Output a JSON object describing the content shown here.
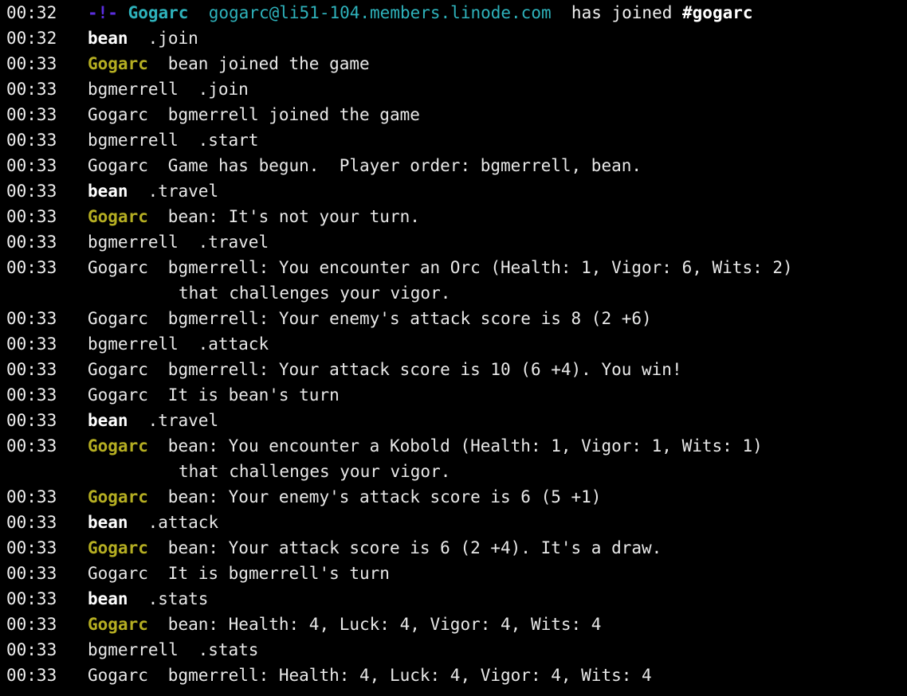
{
  "terminal": {
    "background_color": "#000000",
    "foreground_color": "#e8e8e8",
    "highlight_nick_color": "#b5ae22",
    "join_nick_color": "#2eb2bb",
    "join_prefix_color": "#5b2ee0",
    "own_nick_color": "#ffffff",
    "channel": "#gogarc",
    "own_nick": "bean"
  },
  "join_line": {
    "timestamp": "00:32",
    "prefix": "-!-",
    "nick": "Gogarc",
    "hostmask": "gogarc@li51-104.members.linode.com",
    "action": "has joined",
    "channel": "#gogarc"
  },
  "lines": [
    {
      "timestamp": "00:32",
      "nick": "bean",
      "style": "bold",
      "message": ".join"
    },
    {
      "timestamp": "00:33",
      "nick": "Gogarc",
      "style": "olive",
      "message": "bean joined the game"
    },
    {
      "timestamp": "00:33",
      "nick": "bgmerrell",
      "style": "plain",
      "message": ".join"
    },
    {
      "timestamp": "00:33",
      "nick": "Gogarc",
      "style": "plain",
      "message": "bgmerrell joined the game"
    },
    {
      "timestamp": "00:33",
      "nick": "bgmerrell",
      "style": "plain",
      "message": ".start"
    },
    {
      "timestamp": "00:33",
      "nick": "Gogarc",
      "style": "plain",
      "message": "Game has begun.  Player order: bgmerrell, bean."
    },
    {
      "timestamp": "00:33",
      "nick": "bean",
      "style": "bold",
      "message": ".travel"
    },
    {
      "timestamp": "00:33",
      "nick": "Gogarc",
      "style": "olive",
      "message": "bean: It's not your turn."
    },
    {
      "timestamp": "00:33",
      "nick": "bgmerrell",
      "style": "plain",
      "message": ".travel"
    },
    {
      "timestamp": "00:33",
      "nick": "Gogarc",
      "style": "plain",
      "message": "bgmerrell: You encounter an Orc (Health: 1, Vigor: 6, Wits: 2)"
    },
    {
      "timestamp": "",
      "nick": "",
      "style": "cont",
      "message": "that challenges your vigor."
    },
    {
      "timestamp": "00:33",
      "nick": "Gogarc",
      "style": "plain",
      "message": "bgmerrell: Your enemy's attack score is 8 (2 +6)"
    },
    {
      "timestamp": "00:33",
      "nick": "bgmerrell",
      "style": "plain",
      "message": ".attack"
    },
    {
      "timestamp": "00:33",
      "nick": "Gogarc",
      "style": "plain",
      "message": "bgmerrell: Your attack score is 10 (6 +4). You win!"
    },
    {
      "timestamp": "00:33",
      "nick": "Gogarc",
      "style": "plain",
      "message": "It is bean's turn"
    },
    {
      "timestamp": "00:33",
      "nick": "bean",
      "style": "bold",
      "message": ".travel"
    },
    {
      "timestamp": "00:33",
      "nick": "Gogarc",
      "style": "olive",
      "message": "bean: You encounter a Kobold (Health: 1, Vigor: 1, Wits: 1)"
    },
    {
      "timestamp": "",
      "nick": "",
      "style": "cont",
      "message": "that challenges your vigor."
    },
    {
      "timestamp": "00:33",
      "nick": "Gogarc",
      "style": "olive",
      "message": "bean: Your enemy's attack score is 6 (5 +1)"
    },
    {
      "timestamp": "00:33",
      "nick": "bean",
      "style": "bold",
      "message": ".attack"
    },
    {
      "timestamp": "00:33",
      "nick": "Gogarc",
      "style": "olive",
      "message": "bean: Your attack score is 6 (2 +4). It's a draw."
    },
    {
      "timestamp": "00:33",
      "nick": "Gogarc",
      "style": "plain",
      "message": "It is bgmerrell's turn"
    },
    {
      "timestamp": "00:33",
      "nick": "bean",
      "style": "bold",
      "message": ".stats"
    },
    {
      "timestamp": "00:33",
      "nick": "Gogarc",
      "style": "olive",
      "message": "bean: Health: 4, Luck: 4, Vigor: 4, Wits: 4"
    },
    {
      "timestamp": "00:33",
      "nick": "bgmerrell",
      "style": "plain",
      "message": ".stats"
    },
    {
      "timestamp": "00:33",
      "nick": "Gogarc",
      "style": "plain",
      "message": "bgmerrell: Health: 4, Luck: 4, Vigor: 4, Wits: 4"
    }
  ]
}
